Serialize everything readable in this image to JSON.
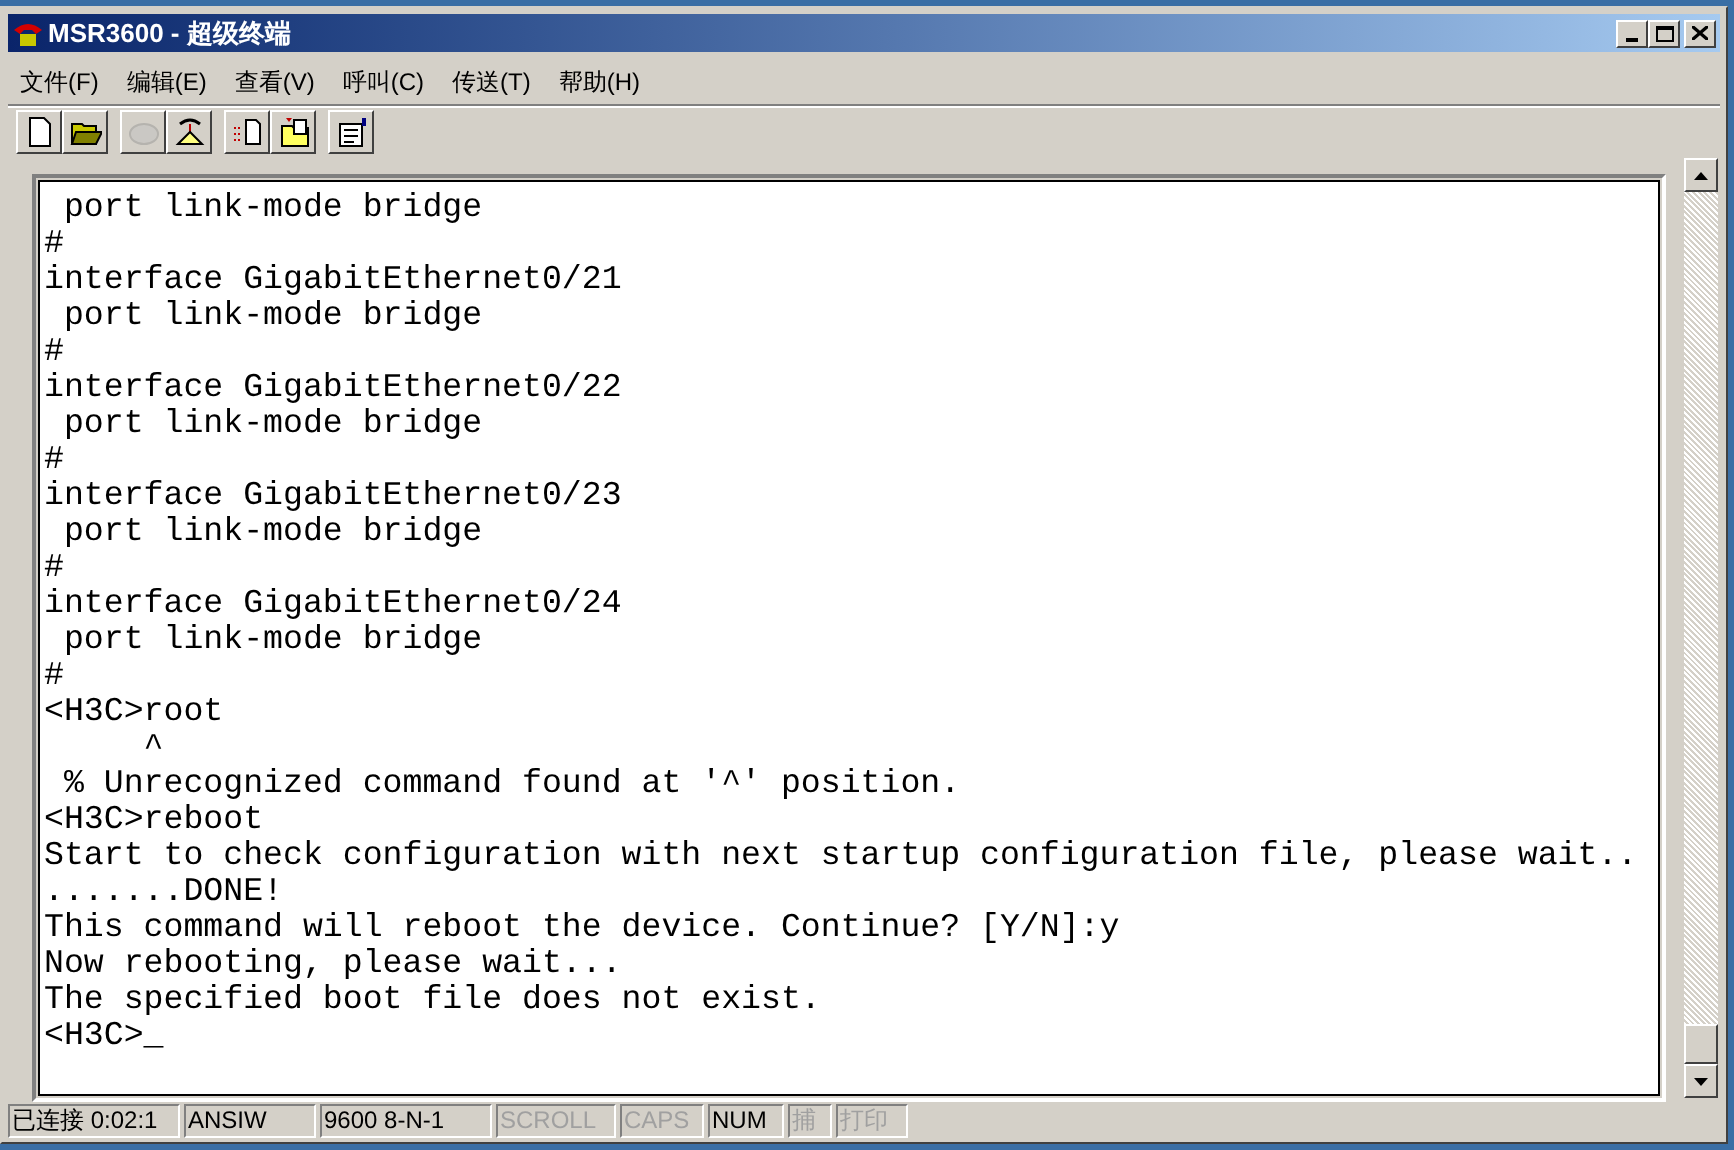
{
  "window": {
    "title": "MSR3600 - 超级终端"
  },
  "menu": [
    "文件(F)",
    "编辑(E)",
    "查看(V)",
    "呼叫(C)",
    "传送(T)",
    "帮助(H)"
  ],
  "toolbar": [
    [
      {
        "kind": "new",
        "disabled": false
      },
      {
        "kind": "open",
        "disabled": false
      }
    ],
    [
      {
        "kind": "disconnect",
        "disabled": true
      },
      {
        "kind": "call",
        "disabled": false
      }
    ],
    [
      {
        "kind": "send",
        "disabled": false
      },
      {
        "kind": "receive",
        "disabled": false
      }
    ],
    [
      {
        "kind": "properties",
        "disabled": false
      }
    ]
  ],
  "terminal": {
    "lines": [
      " port link-mode bridge",
      "#",
      "interface GigabitEthernet0/21",
      " port link-mode bridge",
      "#",
      "interface GigabitEthernet0/22",
      " port link-mode bridge",
      "#",
      "interface GigabitEthernet0/23",
      " port link-mode bridge",
      "#",
      "interface GigabitEthernet0/24",
      " port link-mode bridge",
      "#",
      "<H3C>root",
      "     ^",
      " % Unrecognized command found at '^' position.",
      "<H3C>reboot",
      "Start to check configuration with next startup configuration file, please wait..",
      ".......DONE!",
      "This command will reboot the device. Continue? [Y/N]:y",
      "Now rebooting, please wait...",
      "The specified boot file does not exist.",
      "<H3C>_"
    ]
  },
  "status_bar": [
    {
      "text": "已连接 0:02:1",
      "disabled": false
    },
    {
      "text": "ANSIW",
      "disabled": false
    },
    {
      "text": "9600 8-N-1",
      "disabled": false
    },
    {
      "text": "SCROLL",
      "disabled": true
    },
    {
      "text": "CAPS",
      "disabled": true
    },
    {
      "text": "NUM",
      "disabled": false
    },
    {
      "text": "捕",
      "disabled": true
    },
    {
      "text": "打印",
      "disabled": true
    }
  ]
}
